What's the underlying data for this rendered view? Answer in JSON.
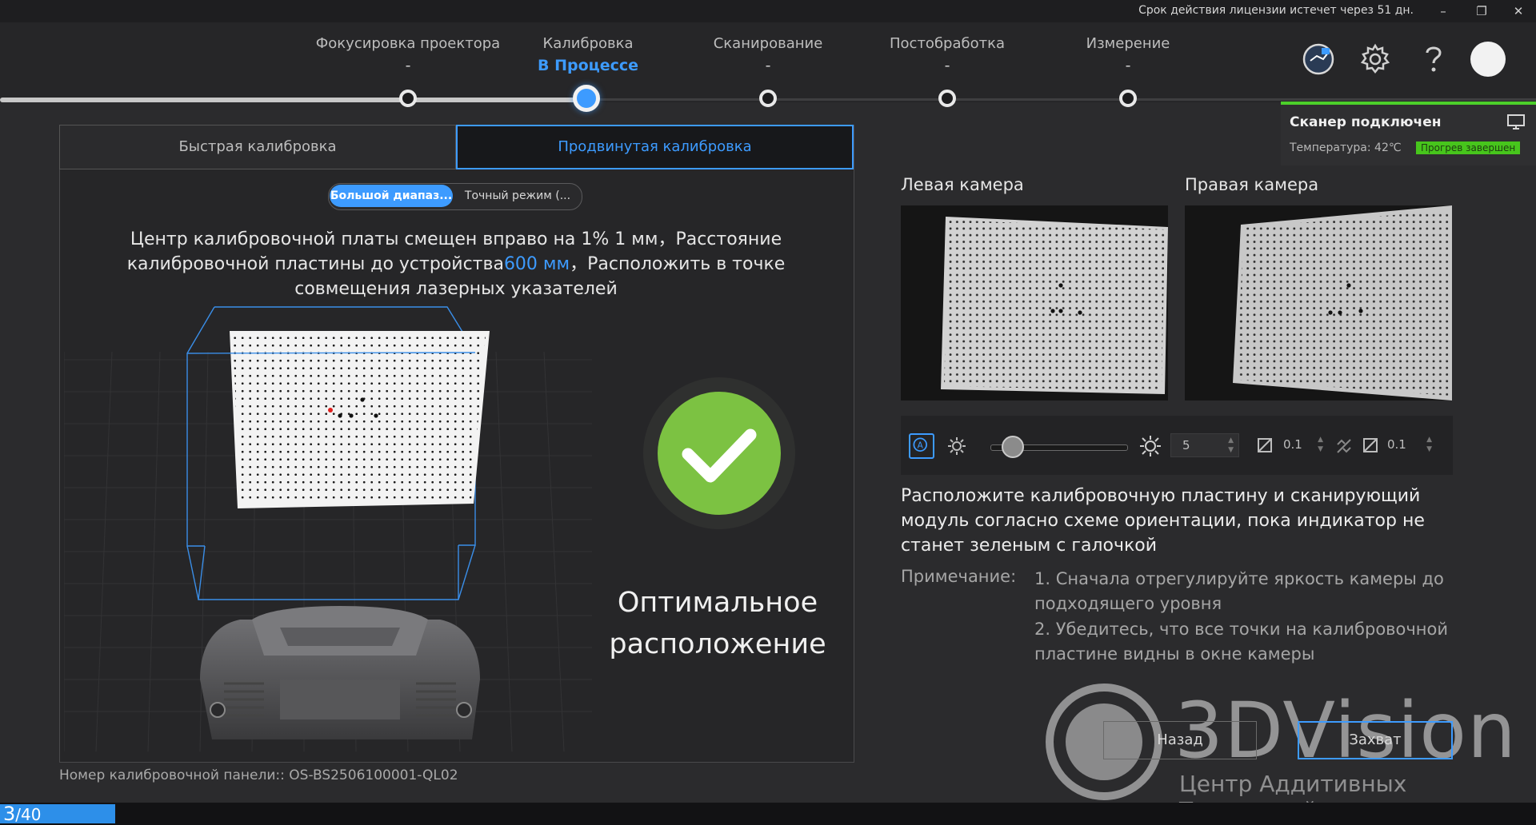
{
  "titlebar": {
    "license_text": "Срок действия лицензии истечет через 51 дн.",
    "minimize": "–",
    "restore": "❐",
    "close": "✕"
  },
  "steps": [
    {
      "label": "Фокусировка проектора",
      "status": "-"
    },
    {
      "label": "Калибровка",
      "status": "В Процессе",
      "active": true
    },
    {
      "label": "Сканирование",
      "status": "-"
    },
    {
      "label": "Постобработка",
      "status": "-"
    },
    {
      "label": "Измерение",
      "status": "-"
    }
  ],
  "header_icons": [
    "model-icon",
    "gear-icon",
    "help-icon",
    "avatar"
  ],
  "scanner": {
    "title": "Сканер подключен",
    "temperature": "Температура: 42℃",
    "warmup_badge": "Прогрев завершен",
    "accent_color": "#4ccf2a"
  },
  "tabs": {
    "quick": "Быстрая калибровка",
    "advanced": "Продвинутая калибровка"
  },
  "mode": {
    "wide": "Большой диапаз...",
    "precise": "Точный режим (..."
  },
  "instruction": {
    "part1": "Центр калибровочной платы смещен вправо на 1% 1 мм，Расстояние калибровочной пластины до устройства",
    "distance": "600 мм",
    "part2": "，Расположить в точке совмещения лазерных указателей"
  },
  "status_text": "Оптимальное расположение",
  "panel_number_label": "Номер калибровочной панели::",
  "panel_number": "OS-BS2506100001-QL02",
  "cameras": {
    "left": "Левая камера",
    "right": "Правая камера"
  },
  "camera_toolbar": {
    "brightness_value": "5",
    "exposure_left": "0.1",
    "exposure_right": "0.1",
    "brightness_level": 0.1
  },
  "placement_text": "Расположите калибровочную пластину и сканирующий модуль согласно схеме ориентации, пока индикатор не станет зеленым с галочкой",
  "note": {
    "label": "Примечание:",
    "item1": "1. Сначала отрегулируйте яркость камеры до подходящего уровня",
    "item2": "2. Убедитесь, что все точки на калибровочной пластине видны в окне камеры"
  },
  "buttons": {
    "back": "Назад",
    "capture": "Захват"
  },
  "watermark": {
    "title": "3DVision",
    "subtitle": "Центр Аддитивных Технологий"
  },
  "footer": {
    "current_page": "3",
    "total": "/40"
  },
  "colors": {
    "accent": "#3d9bff",
    "ok_green": "#7cc242"
  }
}
